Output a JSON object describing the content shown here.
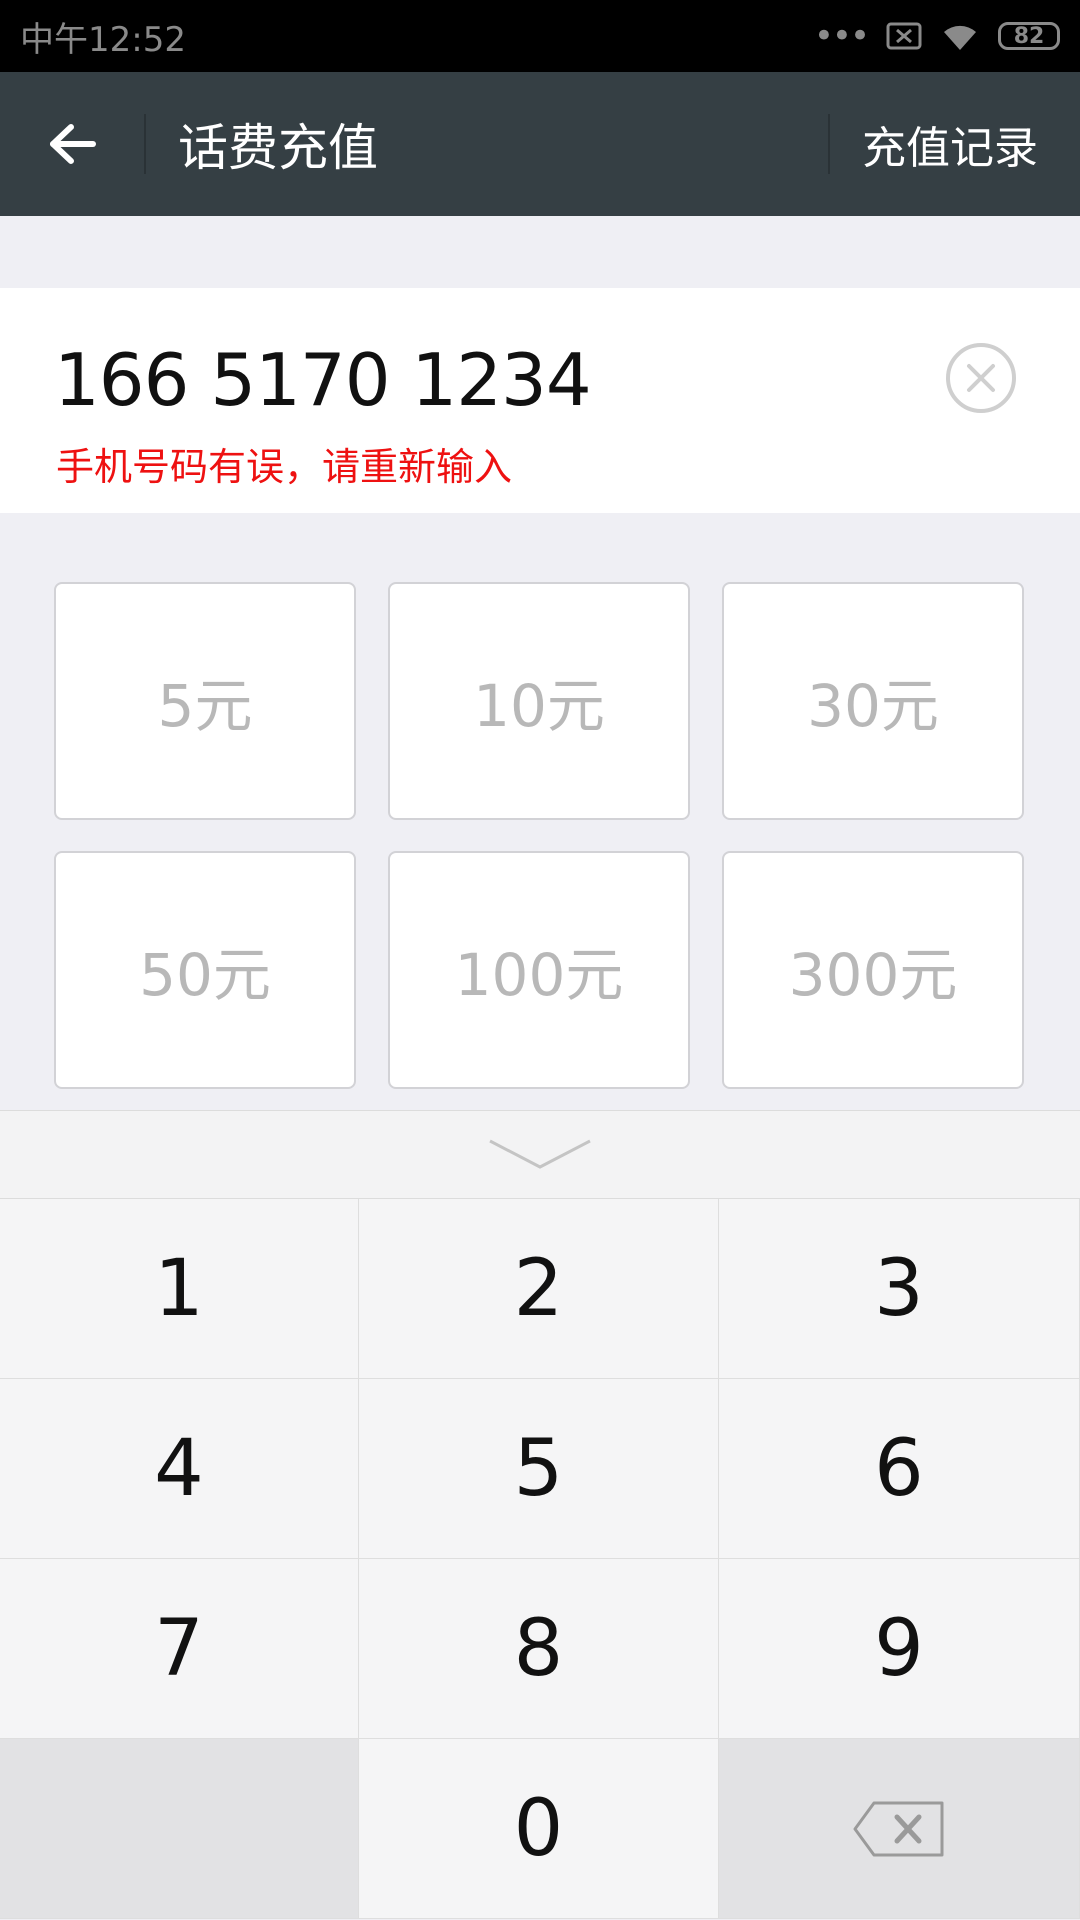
{
  "status_bar": {
    "time": "中午12:52",
    "signal_dots": "•••",
    "battery": "82"
  },
  "app_bar": {
    "title": "话费充值",
    "right_action": "充值记录"
  },
  "phone_input": {
    "value": "166 5170 1234",
    "error": "手机号码有误，请重新输入"
  },
  "amounts": [
    "5元",
    "10元",
    "30元",
    "50元",
    "100元",
    "300元"
  ],
  "keypad": {
    "keys": [
      "1",
      "2",
      "3",
      "4",
      "5",
      "6",
      "7",
      "8",
      "9",
      "",
      "0",
      ""
    ]
  },
  "colors": {
    "app_bar_bg": "#353f44",
    "error_text": "#ee1111",
    "amount_text": "#b8b8b8",
    "page_bg": "#efeff4"
  },
  "icons": [
    "back-arrow-icon",
    "clear-circle-icon",
    "chevron-down-icon",
    "backspace-icon",
    "wifi-icon",
    "sim-error-icon"
  ]
}
